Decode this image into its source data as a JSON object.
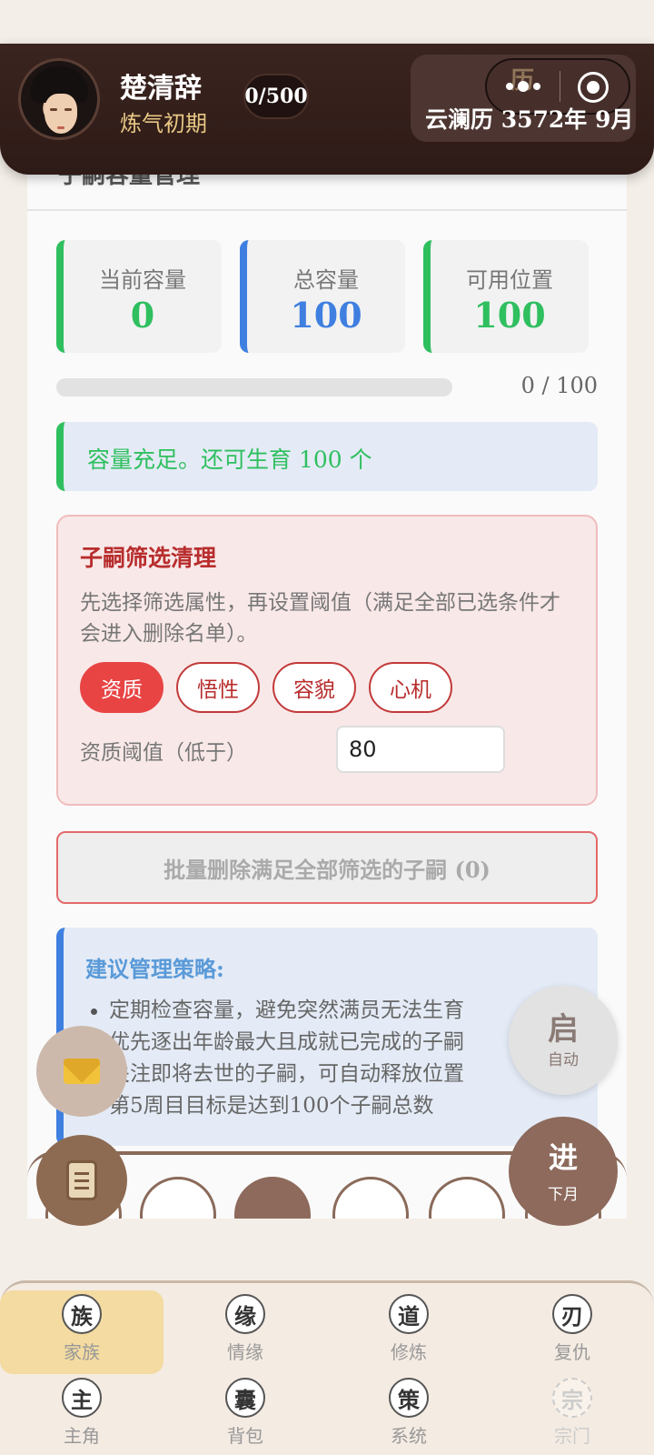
{
  "header": {
    "character_name": "楚清辞",
    "realm": "炼气初期",
    "count_badge": "0/500",
    "calendar_char": "历",
    "date_text": "云澜历 3572年 9月"
  },
  "panel": {
    "title": "子嗣容量管理",
    "stats": [
      {
        "label": "当前容量",
        "value": "0",
        "color": "#2fbf5f"
      },
      {
        "label": "总容量",
        "value": "100",
        "color": "#3f7fe0"
      },
      {
        "label": "可用位置",
        "value": "100",
        "color": "#2fbf5f"
      }
    ],
    "progress": {
      "text": "0 / 100",
      "fraction": 0
    },
    "notice": "容量充足。还可生育 100 个",
    "filter": {
      "title": "子嗣筛选清理",
      "description": "先选择筛选属性，再设置阈值（满足全部已选条件才会进入删除名单）。",
      "chips": [
        {
          "label": "资质",
          "active": true
        },
        {
          "label": "悟性",
          "active": false
        },
        {
          "label": "容貌",
          "active": false
        },
        {
          "label": "心机",
          "active": false
        }
      ],
      "threshold_label": "资质阈值（低于）",
      "threshold_value": "80"
    },
    "delete_button": "批量删除满足全部筛选的子嗣 (0)",
    "tips": {
      "title": "建议管理策略:",
      "items": [
        "定期检查容量，避免突然满员无法生育",
        "优先逐出年龄最大且成就已完成的子嗣",
        "关注即将去世的子嗣，可自动释放位置",
        "第5周目目标是达到100个子嗣总数"
      ]
    }
  },
  "fabs": {
    "mail_icon": "mail-icon",
    "scroll_icon": "scroll-icon",
    "auto": {
      "big": "启",
      "small": "自动"
    },
    "next": {
      "big": "进",
      "small": "下月"
    }
  },
  "nav": [
    {
      "glyph": "族",
      "label": "家族",
      "active": true
    },
    {
      "glyph": "缘",
      "label": "情缘"
    },
    {
      "glyph": "道",
      "label": "修炼"
    },
    {
      "glyph": "刃",
      "label": "复仇"
    },
    {
      "glyph": "主",
      "label": "主角"
    },
    {
      "glyph": "囊",
      "label": "背包"
    },
    {
      "glyph": "策",
      "label": "系统"
    },
    {
      "glyph": "宗",
      "label": "宗门",
      "disabled": true
    }
  ],
  "colors": {
    "accent_green": "#2fbf5f",
    "accent_blue": "#3f7fe0",
    "accent_red": "#e84444",
    "header_bg": "#2e1a16",
    "brown": "#8d6a5c"
  }
}
